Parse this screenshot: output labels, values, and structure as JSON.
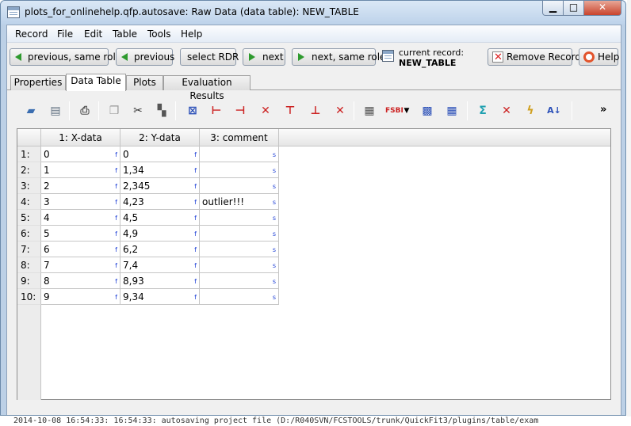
{
  "window": {
    "title": "plots_for_onlinehelp.qfp.autosave: Raw Data (data table): NEW_TABLE",
    "minimize": "▁",
    "maximize": "□",
    "close": "✕"
  },
  "menu": [
    "Record",
    "File",
    "Edit",
    "Table",
    "Tools",
    "Help"
  ],
  "nav": {
    "prev_same_role": "previous, same role",
    "previous": "previous",
    "select_rdr": "select RDR",
    "next": "next",
    "next_same_role": "next, same role",
    "current_record_label": "current record:",
    "current_record_value": "NEW_TABLE",
    "remove_record": "Remove Record",
    "help": "Help"
  },
  "tabs": [
    "Properties",
    "Data Table",
    "Plots",
    "Evaluation Results"
  ],
  "active_tab": "Data Table",
  "toolbar": {
    "more": "»"
  },
  "table": {
    "columns": [
      "1: X-data",
      "2: Y-data",
      "3: comment"
    ],
    "type_flags": [
      "f",
      "f",
      "s"
    ],
    "row_labels": [
      "1:",
      "2:",
      "3:",
      "4:",
      "5:",
      "6:",
      "7:",
      "8:",
      "9:",
      "10:"
    ],
    "rows": [
      [
        "0",
        "0",
        ""
      ],
      [
        "1",
        "1,34",
        ""
      ],
      [
        "2",
        "2,345",
        ""
      ],
      [
        "3",
        "4,23",
        "outlier!!!"
      ],
      [
        "4",
        "4,5",
        ""
      ],
      [
        "5",
        "4,9",
        ""
      ],
      [
        "6",
        "6,2",
        ""
      ],
      [
        "7",
        "7,4",
        ""
      ],
      [
        "8",
        "8,93",
        ""
      ],
      [
        "9",
        "9,34",
        ""
      ]
    ]
  },
  "log_line": "2014-10-08 16:54:33: 16:54:33: autosaving project file (D:/R040SVN/FCSTOOLS/trunk/QuickFit3/plugins/table/exam"
}
